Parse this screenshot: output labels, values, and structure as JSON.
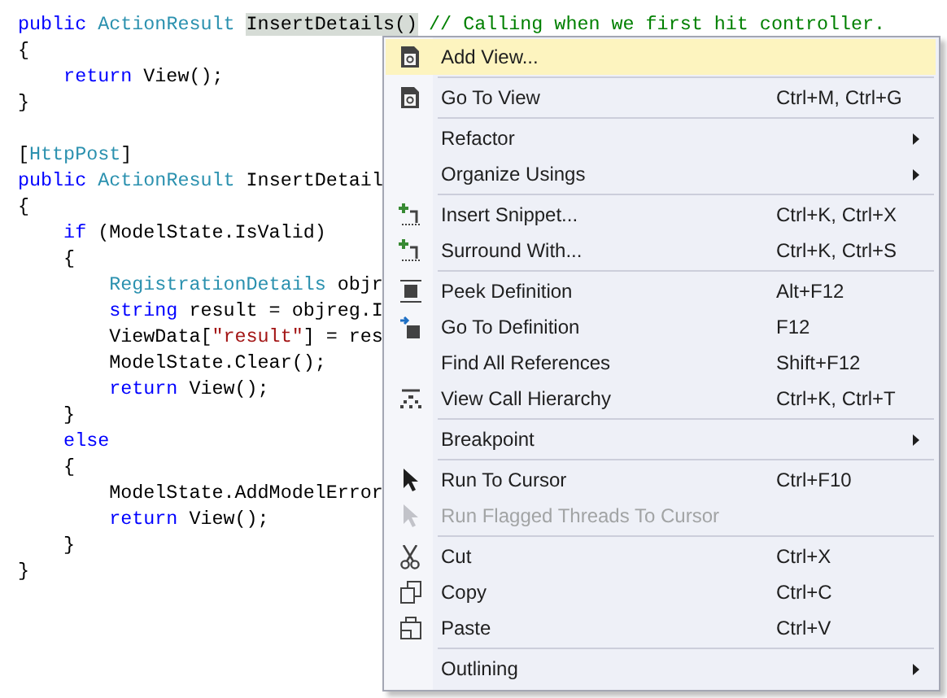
{
  "code_lines": [
    {
      "kind": "code",
      "tokens": [
        {
          "kind": "keyword",
          "text": "public "
        },
        {
          "kind": "type",
          "text": "ActionResult "
        },
        {
          "kind": "plain",
          "text": "InsertDetails()",
          "highlighted": true
        },
        {
          "kind": "comment",
          "text": " // Calling when we first hit controller."
        }
      ]
    },
    {
      "kind": "code",
      "tokens": [
        {
          "kind": "plain",
          "text": "{"
        }
      ]
    },
    {
      "kind": "code",
      "tokens": [
        {
          "kind": "keyword",
          "text": "    return"
        },
        {
          "kind": "plain",
          "text": " View();"
        }
      ]
    },
    {
      "kind": "code",
      "tokens": [
        {
          "kind": "plain",
          "text": "}"
        }
      ]
    },
    {
      "kind": "blank"
    },
    {
      "kind": "code",
      "tokens": [
        {
          "kind": "plain",
          "text": "["
        },
        {
          "kind": "type",
          "text": "HttpPost"
        },
        {
          "kind": "plain",
          "text": "]"
        }
      ]
    },
    {
      "kind": "code",
      "tokens": [
        {
          "kind": "keyword",
          "text": "public "
        },
        {
          "kind": "type",
          "text": "ActionResult "
        },
        {
          "kind": "plain",
          "text": "InsertDetail"
        }
      ]
    },
    {
      "kind": "code",
      "tokens": [
        {
          "kind": "plain",
          "text": "{"
        }
      ]
    },
    {
      "kind": "code",
      "tokens": [
        {
          "kind": "keyword",
          "text": "    if"
        },
        {
          "kind": "plain",
          "text": " (ModelState.IsValid)"
        }
      ]
    },
    {
      "kind": "code",
      "tokens": [
        {
          "kind": "plain",
          "text": "    {"
        }
      ]
    },
    {
      "kind": "code",
      "tokens": [
        {
          "kind": "type",
          "text": "        RegistrationDetails"
        },
        {
          "kind": "plain",
          "text": " objr"
        }
      ]
    },
    {
      "kind": "code",
      "tokens": [
        {
          "kind": "keyword",
          "text": "        string"
        },
        {
          "kind": "plain",
          "text": " result = objreg.I"
        }
      ]
    },
    {
      "kind": "code",
      "tokens": [
        {
          "kind": "plain",
          "text": "        ViewData["
        },
        {
          "kind": "string",
          "text": "\"result\""
        },
        {
          "kind": "plain",
          "text": "] = res"
        }
      ]
    },
    {
      "kind": "code",
      "tokens": [
        {
          "kind": "plain",
          "text": "        ModelState.Clear();"
        }
      ]
    },
    {
      "kind": "code",
      "tokens": [
        {
          "kind": "keyword",
          "text": "        return"
        },
        {
          "kind": "plain",
          "text": " View();"
        }
      ]
    },
    {
      "kind": "code",
      "tokens": [
        {
          "kind": "plain",
          "text": "    }"
        }
      ]
    },
    {
      "kind": "code",
      "tokens": [
        {
          "kind": "keyword",
          "text": "    else"
        }
      ]
    },
    {
      "kind": "code",
      "tokens": [
        {
          "kind": "plain",
          "text": "    {"
        }
      ]
    },
    {
      "kind": "code",
      "tokens": [
        {
          "kind": "plain",
          "text": "        ModelState.AddModelError"
        }
      ]
    },
    {
      "kind": "code",
      "tokens": [
        {
          "kind": "keyword",
          "text": "        return"
        },
        {
          "kind": "plain",
          "text": " View();"
        }
      ]
    },
    {
      "kind": "code",
      "tokens": [
        {
          "kind": "plain",
          "text": "    }"
        }
      ]
    },
    {
      "kind": "code",
      "tokens": [
        {
          "kind": "plain",
          "text": "}"
        }
      ]
    }
  ],
  "context_menu": {
    "groups": [
      [
        {
          "kind": "document",
          "label": "Add View...",
          "submenu": false,
          "disabled": false,
          "selected": true
        }
      ],
      [
        {
          "kind": "document",
          "label": "Go To View",
          "shortcut": "Ctrl+M, Ctrl+G",
          "submenu": false,
          "disabled": false,
          "selected": false
        }
      ],
      [
        {
          "kind": "plain",
          "label": "Refactor",
          "submenu": true,
          "disabled": false,
          "selected": false
        },
        {
          "kind": "plain",
          "label": "Organize Usings",
          "submenu": true,
          "disabled": false,
          "selected": false
        }
      ],
      [
        {
          "kind": "snippet",
          "label": "Insert Snippet...",
          "shortcut": "Ctrl+K, Ctrl+X",
          "submenu": false,
          "disabled": false,
          "selected": false
        },
        {
          "kind": "snippet",
          "label": "Surround With...",
          "shortcut": "Ctrl+K, Ctrl+S",
          "submenu": false,
          "disabled": false,
          "selected": false
        }
      ],
      [
        {
          "kind": "peek",
          "label": "Peek Definition",
          "shortcut": "Alt+F12",
          "submenu": false,
          "disabled": false,
          "selected": false
        },
        {
          "kind": "goto",
          "label": "Go To Definition",
          "shortcut": "F12",
          "submenu": false,
          "disabled": false,
          "selected": false
        },
        {
          "kind": "plain",
          "label": "Find All References",
          "shortcut": "Shift+F12",
          "submenu": false,
          "disabled": false,
          "selected": false
        },
        {
          "kind": "hierarchy",
          "label": "View Call Hierarchy",
          "shortcut": "Ctrl+K, Ctrl+T",
          "submenu": false,
          "disabled": false,
          "selected": false
        }
      ],
      [
        {
          "kind": "plain",
          "label": "Breakpoint",
          "submenu": true,
          "disabled": false,
          "selected": false
        }
      ],
      [
        {
          "kind": "cursor",
          "label": "Run To Cursor",
          "shortcut": "Ctrl+F10",
          "submenu": false,
          "disabled": false,
          "selected": false
        },
        {
          "kind": "cursor",
          "label": "Run Flagged Threads To Cursor",
          "submenu": false,
          "disabled": true,
          "selected": false
        }
      ],
      [
        {
          "kind": "cut",
          "label": "Cut",
          "shortcut": "Ctrl+X",
          "submenu": false,
          "disabled": false,
          "selected": false
        },
        {
          "kind": "copy",
          "label": "Copy",
          "shortcut": "Ctrl+C",
          "submenu": false,
          "disabled": false,
          "selected": false
        },
        {
          "kind": "paste",
          "label": "Paste",
          "shortcut": "Ctrl+V",
          "submenu": false,
          "disabled": false,
          "selected": false
        }
      ],
      [
        {
          "kind": "plain",
          "label": "Outlining",
          "submenu": true,
          "disabled": false,
          "selected": false
        }
      ]
    ]
  }
}
